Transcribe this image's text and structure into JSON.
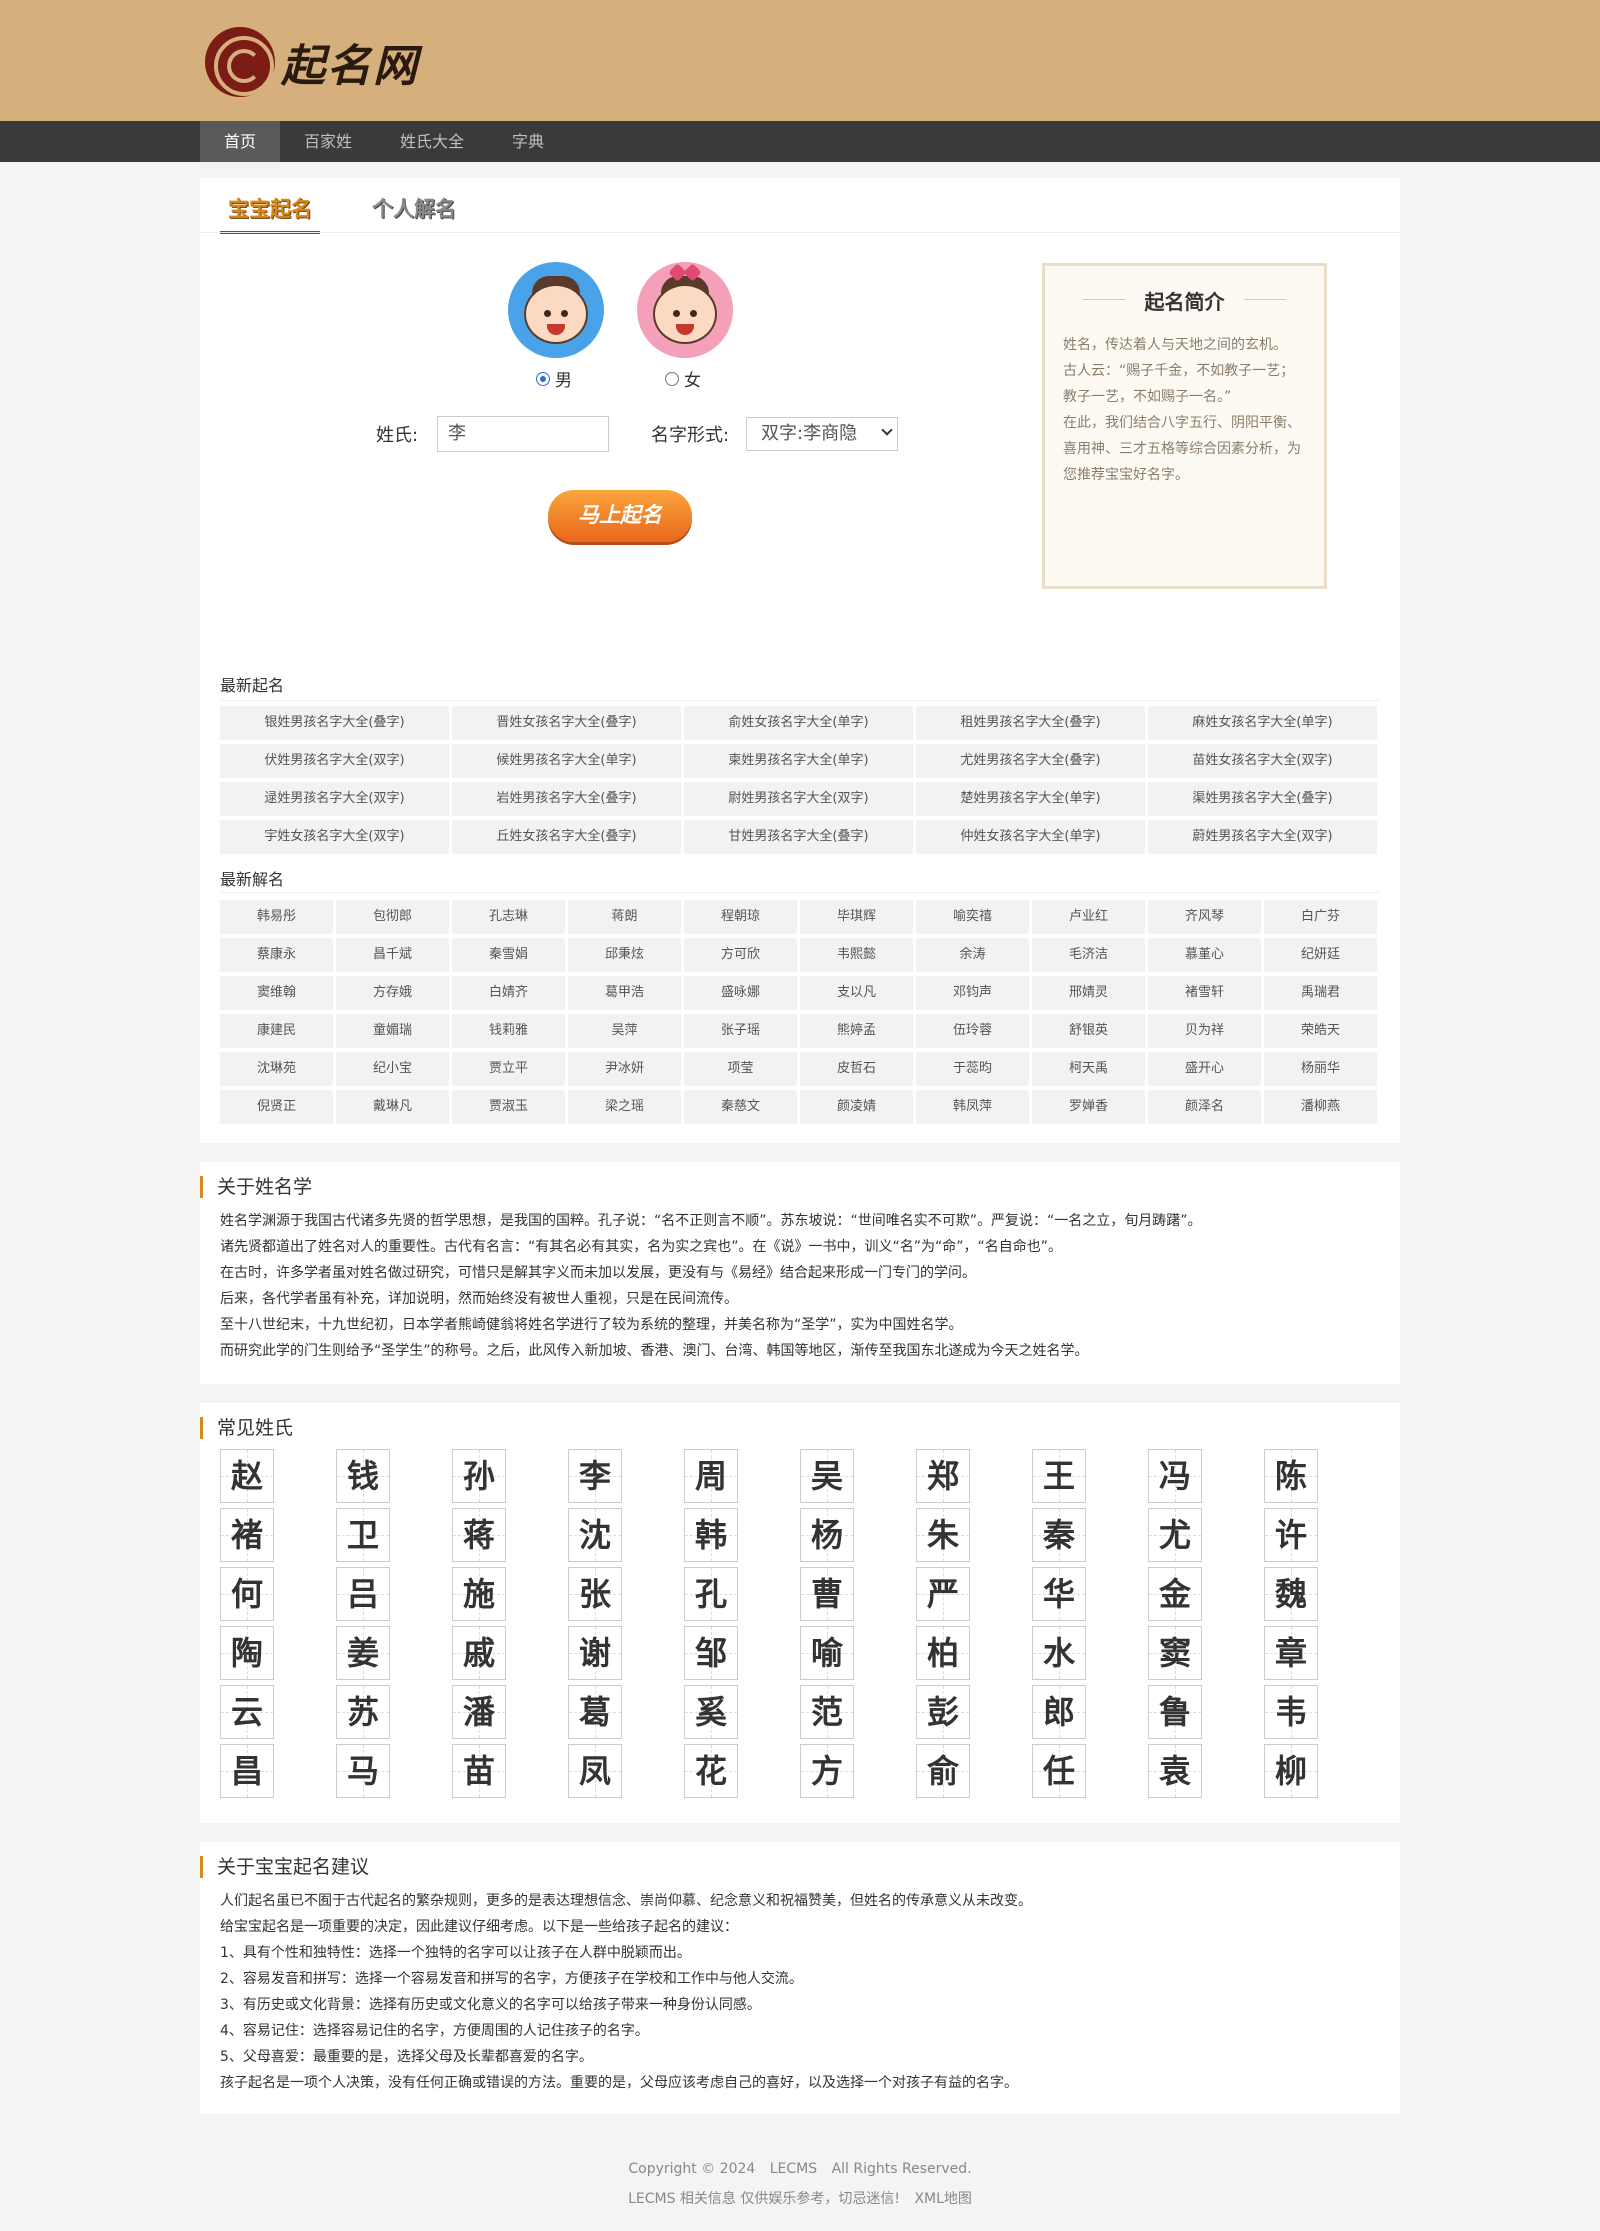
{
  "logo": {
    "text": "起名网"
  },
  "nav": [
    "首页",
    "百家姓",
    "姓氏大全",
    "字典"
  ],
  "tabs": [
    "宝宝起名",
    "个人解名"
  ],
  "form": {
    "male_label": "男",
    "female_label": "女",
    "surname_label": "姓氏:",
    "surname_value": "李",
    "format_label": "名字形式:",
    "format_value": "双字:李商隐",
    "submit_label": "马上起名"
  },
  "intro": {
    "title": "起名简介",
    "lines": [
      "姓名，传达着人与天地之间的玄机。",
      "古人云：“赐子千金，不如教子一艺；",
      "教子一艺，不如赐子一名。”",
      "在此，我们结合八字五行、阴阳平衡、",
      "喜用神、三才五格等综合因素分析，为",
      "您推荐宝宝好名字。"
    ]
  },
  "latest_names": {
    "title": "最新起名",
    "items": [
      "银姓男孩名字大全(叠字)",
      "晋姓女孩名字大全(叠字)",
      "俞姓女孩名字大全(单字)",
      "租姓男孩名字大全(叠字)",
      "麻姓女孩名字大全(单字)",
      "伏姓男孩名字大全(双字)",
      "候姓男孩名字大全(单字)",
      "柬姓男孩名字大全(单字)",
      "尤姓男孩名字大全(叠字)",
      "苗姓女孩名字大全(双字)",
      "逯姓男孩名字大全(双字)",
      "岩姓男孩名字大全(叠字)",
      "尉姓男孩名字大全(双字)",
      "楚姓男孩名字大全(单字)",
      "渠姓男孩名字大全(叠字)",
      "宇姓女孩名字大全(双字)",
      "丘姓女孩名字大全(叠字)",
      "甘姓男孩名字大全(叠字)",
      "仲姓女孩名字大全(单字)",
      "蔚姓男孩名字大全(双字)"
    ]
  },
  "latest_interp": {
    "title": "最新解名",
    "items": [
      "韩易彤",
      "包彻郎",
      "孔志琳",
      "蒋朗",
      "程朝琼",
      "毕琪辉",
      "喻奕禧",
      "卢业红",
      "齐风琴",
      "白广芬",
      "蔡康永",
      "昌千斌",
      "秦雪娟",
      "邱秉炫",
      "方可欣",
      "韦熙懿",
      "余涛",
      "毛济洁",
      "慕堇心",
      "纪妍廷",
      "窦维翰",
      "方存娥",
      "白婧齐",
      "葛甲浩",
      "盛咏娜",
      "支以凡",
      "邓钧声",
      "邢婧灵",
      "褚雪轩",
      "禹瑞君",
      "康建民",
      "童媚瑞",
      "钱莉雅",
      "吴萍",
      "张子瑶",
      "熊婷孟",
      "伍玲蓉",
      "舒银英",
      "贝为祥",
      "荣皓天",
      "沈琳苑",
      "纪小宝",
      "贾立平",
      "尹冰妍",
      "项莹",
      "皮哲石",
      "于蕊昀",
      "柯天禹",
      "盛开心",
      "杨丽华",
      "倪贤正",
      "戴琳凡",
      "贾淑玉",
      "梁之瑶",
      "秦慈文",
      "颜凌婧",
      "韩凤萍",
      "罗婵香",
      "颜泽名",
      "潘柳燕"
    ]
  },
  "about": {
    "title": "关于姓名学",
    "lines": [
      "姓名学渊源于我国古代诸多先贤的哲学思想，是我国的国粹。孔子说：“名不正则言不顺”。苏东坡说：“世间唯名实不可欺”。严复说：“一名之立，旬月踌躇”。",
      "诸先贤都道出了姓名对人的重要性。古代有名言：“有其名必有其实，名为实之宾也”。在《说》一书中，训义“名”为“命”，“名自命也”。",
      "在古时，许多学者虽对姓名做过研究，可惜只是解其字义而未加以发展，更没有与《易经》结合起来形成一门专门的学问。",
      "后来，各代学者虽有补充，详加说明，然而始终没有被世人重视，只是在民间流传。",
      "至十八世纪末，十九世纪初，日本学者熊崎健翁将姓名学进行了较为系统的整理，并美名称为“圣学”，实为中国姓名学。",
      "而研究此学的门生则给予“圣学生”的称号。之后，此风传入新加坡、香港、澳门、台湾、韩国等地区，渐传至我国东北遂成为今天之姓名学。"
    ]
  },
  "surnames": {
    "title": "常见姓氏",
    "items": [
      "赵",
      "钱",
      "孙",
      "李",
      "周",
      "吴",
      "郑",
      "王",
      "冯",
      "陈",
      "褚",
      "卫",
      "蒋",
      "沈",
      "韩",
      "杨",
      "朱",
      "秦",
      "尤",
      "许",
      "何",
      "吕",
      "施",
      "张",
      "孔",
      "曹",
      "严",
      "华",
      "金",
      "魏",
      "陶",
      "姜",
      "戚",
      "谢",
      "邹",
      "喻",
      "柏",
      "水",
      "窦",
      "章",
      "云",
      "苏",
      "潘",
      "葛",
      "奚",
      "范",
      "彭",
      "郎",
      "鲁",
      "韦",
      "昌",
      "马",
      "苗",
      "凤",
      "花",
      "方",
      "俞",
      "任",
      "袁",
      "柳"
    ]
  },
  "advice": {
    "title": "关于宝宝起名建议",
    "lines": [
      "人们起名虽已不囿于古代起名的繁杂规则，更多的是表达理想信念、崇尚仰慕、纪念意义和祝福赞美，但姓名的传承意义从未改变。",
      "给宝宝起名是一项重要的决定，因此建议仔细考虑。以下是一些给孩子起名的建议：",
      "1、具有个性和独特性：选择一个独特的名字可以让孩子在人群中脱颖而出。",
      "2、容易发音和拼写：选择一个容易发音和拼写的名字，方便孩子在学校和工作中与他人交流。",
      "3、有历史或文化背景：选择有历史或文化意义的名字可以给孩子带来一种身份认同感。",
      "4、容易记住：选择容易记住的名字，方便周围的人记住孩子的名字。",
      "5、父母喜爱：最重要的是，选择父母及长辈都喜爱的名字。",
      "孩子起名是一项个人决策，没有任何正确或错误的方法。重要的是，父母应该考虑自己的喜好，以及选择一个对孩子有益的名字。"
    ]
  },
  "footer": {
    "line1": [
      "Copyright © 2024",
      "LECMS",
      "All Rights Reserved."
    ],
    "line2": [
      "LECMS 相关信息 仅供娱乐参考，切忌迷信!",
      "XML地图"
    ]
  },
  "colors": {
    "header_bg": "#d6b07c",
    "nav_bg": "#3a3a3a",
    "accent": "#d68a17",
    "button": "#f08a2a"
  }
}
